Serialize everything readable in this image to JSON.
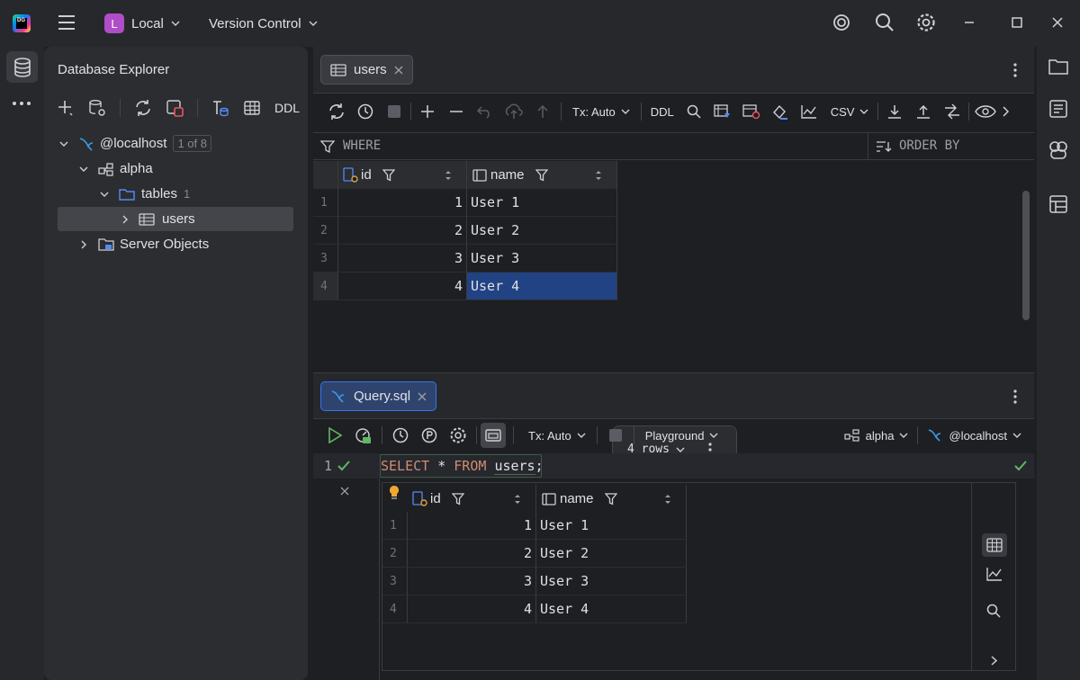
{
  "titlebar": {
    "logo_text": "DG",
    "project_initial": "L",
    "project_name": "Local",
    "vcs_label": "Version Control"
  },
  "explorer": {
    "title": "Database Explorer",
    "toolbar_ddl": "DDL",
    "tree": {
      "host": "@localhost",
      "host_count": "1 of 8",
      "schema": "alpha",
      "tables_label": "tables",
      "tables_count": "1",
      "table": "users",
      "server_objects": "Server Objects"
    }
  },
  "data_editor": {
    "tab_label": "users",
    "tx_mode": "Tx: Auto",
    "ddl_label": "DDL",
    "csv_label": "CSV",
    "where_label": "WHERE",
    "orderby_label": "ORDER BY",
    "columns": [
      "id",
      "name"
    ],
    "rows": [
      {
        "num": "1",
        "id": "1",
        "name": "User 1"
      },
      {
        "num": "2",
        "id": "2",
        "name": "User 2"
      },
      {
        "num": "3",
        "id": "3",
        "name": "User 3"
      },
      {
        "num": "4",
        "id": "4",
        "name": "User 4"
      }
    ],
    "rows_label": "4 rows"
  },
  "query": {
    "tab_label": "Query.sql",
    "tx_mode": "Tx: Auto",
    "playground": "Playground",
    "schema": "alpha",
    "datasource": "@localhost",
    "line_number": "1",
    "sql": {
      "kw1": "SELECT",
      "star": "*",
      "kw2": "FROM",
      "table": "users",
      "semi": ";"
    },
    "result_columns": [
      "id",
      "name"
    ],
    "result_rows": [
      {
        "num": "1",
        "id": "1",
        "name": "User 1"
      },
      {
        "num": "2",
        "id": "2",
        "name": "User 2"
      },
      {
        "num": "3",
        "id": "3",
        "name": "User 3"
      },
      {
        "num": "4",
        "id": "4",
        "name": "User 4"
      }
    ]
  },
  "colors": {
    "background": "#1e1f22",
    "panel": "#2b2d30",
    "accent_blue": "#3574f0",
    "selection": "#2e436e",
    "keyword": "#cf8e6d",
    "success": "#5fb865"
  }
}
